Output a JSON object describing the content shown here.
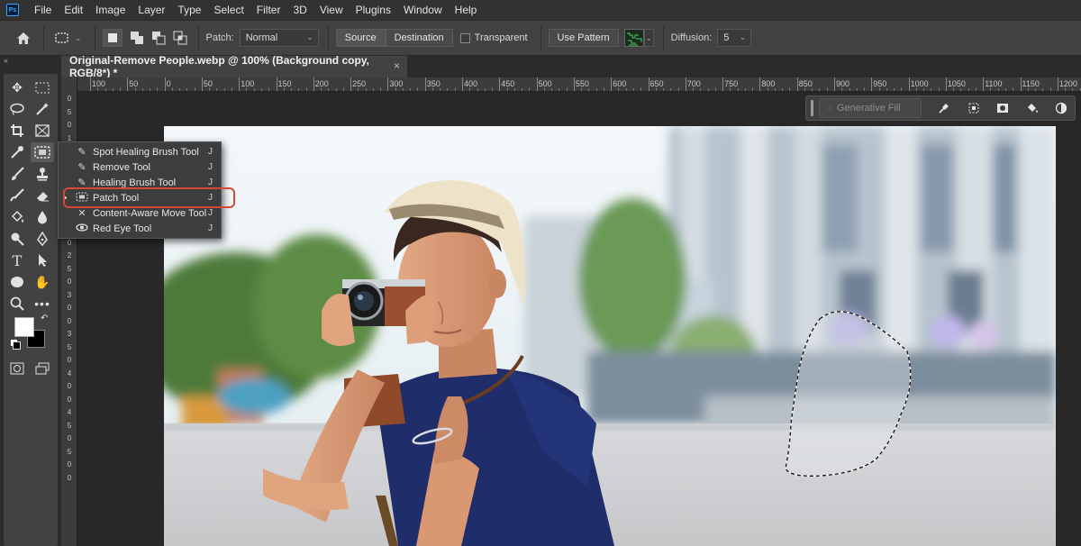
{
  "app": {
    "logo": "Ps"
  },
  "menu": [
    "File",
    "Edit",
    "Image",
    "Layer",
    "Type",
    "Select",
    "Filter",
    "3D",
    "View",
    "Plugins",
    "Window",
    "Help"
  ],
  "options": {
    "patch_label": "Patch:",
    "patch_mode": "Normal",
    "source_label": "Source",
    "destination_label": "Destination",
    "transparent_label": "Transparent",
    "use_pattern_label": "Use Pattern",
    "diffusion_label": "Diffusion:",
    "diffusion_value": "5"
  },
  "document": {
    "tab_title": "Original-Remove People.webp @ 100% (Background copy, RGB/8*) *",
    "close": "×"
  },
  "ruler": {
    "top": [
      "100",
      "50",
      "0",
      "50",
      "100",
      "150",
      "200",
      "250",
      "300",
      "350",
      "400",
      "450",
      "500",
      "550",
      "600",
      "650",
      "700",
      "750",
      "800",
      "850",
      "900",
      "950",
      "1000",
      "1050",
      "1100",
      "1150",
      "1200"
    ],
    "left": [
      "0",
      "5",
      "0",
      "1",
      "0",
      "0",
      "1",
      "5",
      "0",
      "2",
      "0",
      "0",
      "2",
      "5",
      "0",
      "3",
      "0",
      "0",
      "3",
      "5",
      "0",
      "4",
      "0",
      "0",
      "4",
      "5",
      "0",
      "5",
      "0",
      "0"
    ]
  },
  "context_bar": {
    "generative_fill": "Generative Fill"
  },
  "flyout": [
    {
      "label": "Spot Healing Brush Tool",
      "key": "J",
      "icon": "spot-healing-brush-icon"
    },
    {
      "label": "Remove Tool",
      "key": "J",
      "icon": "remove-tool-icon"
    },
    {
      "label": "Healing Brush Tool",
      "key": "J",
      "icon": "healing-brush-icon"
    },
    {
      "label": "Patch Tool",
      "key": "J",
      "icon": "patch-icon",
      "active": true
    },
    {
      "label": "Content-Aware Move Tool",
      "key": "J",
      "icon": "content-aware-move-icon"
    },
    {
      "label": "Red Eye Tool",
      "key": "J",
      "icon": "red-eye-icon"
    }
  ],
  "colors": {
    "highlight_ring": "#d4483a",
    "foreground": "#ffffff",
    "background": "#000000"
  }
}
